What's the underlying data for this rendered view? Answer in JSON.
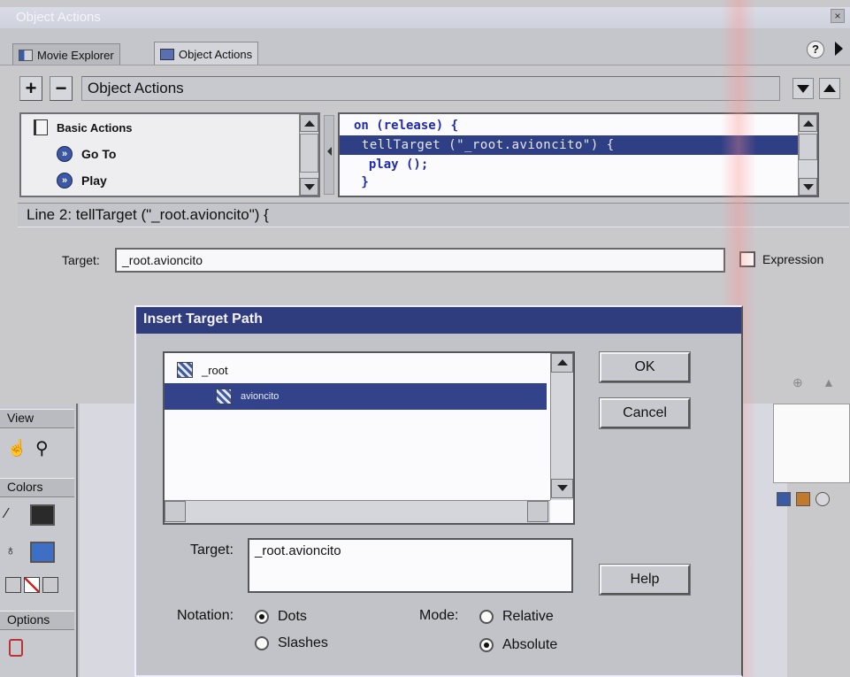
{
  "window": {
    "title": "Object Actions",
    "close_glyph": "×"
  },
  "tabs": [
    {
      "label": "Movie Explorer",
      "icon": "movie-explorer-icon"
    },
    {
      "label": "Object Actions",
      "icon": "object-actions-icon"
    }
  ],
  "help_glyph": "?",
  "toolbar": {
    "add_glyph": "+",
    "remove_glyph": "−",
    "field_text": "Object Actions"
  },
  "toolbox": {
    "items": [
      {
        "label": "Basic Actions",
        "icon": "book-icon"
      },
      {
        "label": "Go To",
        "icon": "action-icon"
      },
      {
        "label": "Play",
        "icon": "action-icon"
      }
    ]
  },
  "code": {
    "lines": [
      "on (release) {",
      " tellTarget (\"_root.avioncito\") {",
      "  play ();",
      " }"
    ],
    "selected_line": 1
  },
  "status": {
    "line_text": "Line 2: tellTarget (\"_root.avioncito\") {"
  },
  "params": {
    "target_label": "Target:",
    "target_value": "_root.avioncito",
    "expression_label": "Expression",
    "expression_checked": false
  },
  "left_panel": {
    "view_label": "View",
    "colors_label": "Colors",
    "options_label": "Options"
  },
  "dialog": {
    "title": "Insert Target Path",
    "tree": [
      {
        "label": "_root",
        "level": 0,
        "selected": false
      },
      {
        "label": "avioncito",
        "level": 1,
        "selected": true
      }
    ],
    "ok_label": "OK",
    "cancel_label": "Cancel",
    "help_label": "Help",
    "target_label": "Target:",
    "target_value": "_root.avioncito",
    "notation_label": "Notation:",
    "notation_options": [
      "Dots",
      "Slashes"
    ],
    "notation_selected": "Dots",
    "mode_label": "Mode:",
    "mode_options": [
      "Relative",
      "Absolute"
    ],
    "mode_selected": "Absolute"
  },
  "colors": {
    "selection": "#2f3f86",
    "dialog_title_bg": "#2f3c7e",
    "code_text": "#1d2ab3",
    "stroke_swatch": "#2a2a2a",
    "fill_swatch": "#3f6fc4"
  }
}
